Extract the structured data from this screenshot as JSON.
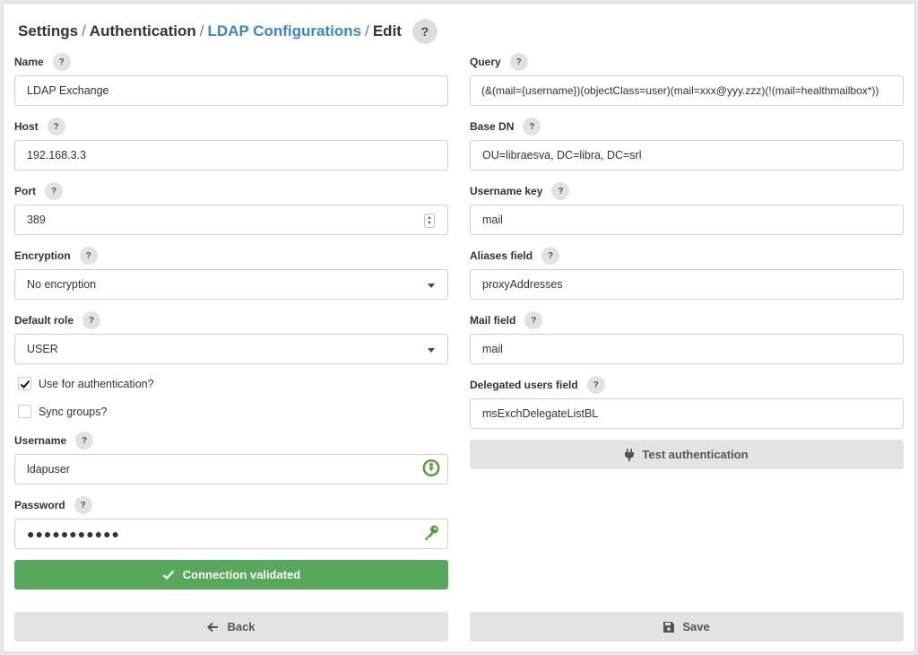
{
  "breadcrumb": {
    "settings": "Settings",
    "authentication": "Authentication",
    "ldap": "LDAP Configurations",
    "edit": "Edit",
    "separator": "/"
  },
  "help_glyph": "?",
  "left": {
    "name": {
      "label": "Name",
      "value": "LDAP Exchange"
    },
    "host": {
      "label": "Host",
      "value": "192.168.3.3"
    },
    "port": {
      "label": "Port",
      "value": "389"
    },
    "encryption": {
      "label": "Encryption",
      "value": "No encryption"
    },
    "default_role": {
      "label": "Default role",
      "value": "USER"
    },
    "use_for_auth": {
      "label": "Use for authentication?",
      "checked": true
    },
    "sync_groups": {
      "label": "Sync groups?",
      "checked": false
    },
    "username": {
      "label": "Username",
      "value": "ldapuser"
    },
    "password": {
      "label": "Password",
      "value": "●●●●●●●●●●●"
    }
  },
  "right": {
    "query": {
      "label": "Query",
      "value": "(&(mail={username})(objectClass=user)(mail=xxx@yyy.zzz)(!(mail=healthmailbox*))"
    },
    "base_dn": {
      "label": "Base DN",
      "value": "OU=libraesva, DC=libra, DC=srl"
    },
    "username_key": {
      "label": "Username key",
      "value": "mail"
    },
    "aliases_field": {
      "label": "Aliases field",
      "value": "proxyAddresses"
    },
    "mail_field": {
      "label": "Mail field",
      "value": "mail"
    },
    "delegated_users_field": {
      "label": "Delegated users field",
      "value": "msExchDelegateListBL"
    }
  },
  "buttons": {
    "test_auth": "Test authentication",
    "connection_validated": "Connection validated",
    "back": "Back",
    "save": "Save"
  },
  "colors": {
    "link": "#3a87c8",
    "success": "#57a85a",
    "button_grey": "#e3e3e3"
  },
  "icons": {
    "test_auth": "plug-icon",
    "connection_validated": "checkmark-icon",
    "back": "arrow-left-icon",
    "save": "floppy-disk-icon",
    "username_field": "user-avatar-icon",
    "password_field": "key-icon"
  }
}
